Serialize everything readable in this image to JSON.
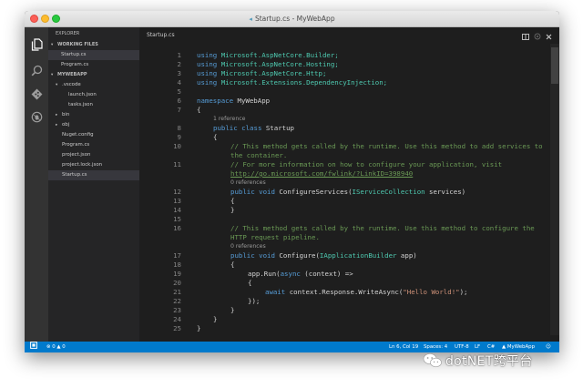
{
  "window": {
    "title": "Startup.cs - MyWebApp"
  },
  "sidebar": {
    "explorer_label": "EXPLORER",
    "working_files": {
      "label": "WORKING FILES",
      "items": [
        "Startup.cs",
        "Program.cs"
      ]
    },
    "project": {
      "label": "MYWEBAPP",
      "tree": [
        ".vscode",
        "launch.json",
        "tasks.json",
        "bin",
        "obj",
        "Nuget.config",
        "Program.cs",
        "project.json",
        "project.lock.json",
        "Startup.cs"
      ]
    }
  },
  "editor": {
    "title": "Startup.cs",
    "lines": [
      {
        "n": "1"
      },
      {
        "n": "2"
      },
      {
        "n": "3"
      },
      {
        "n": "4"
      },
      {
        "n": "5"
      },
      {
        "n": "6"
      },
      {
        "n": "7"
      },
      {
        "lens": "1 reference"
      },
      {
        "n": "8"
      },
      {
        "n": "9"
      },
      {
        "n": "10"
      },
      {
        "n": ""
      },
      {
        "n": "11"
      },
      {
        "n": ""
      },
      {
        "lens": "0 references"
      },
      {
        "n": "12"
      },
      {
        "n": "13"
      },
      {
        "n": "14"
      },
      {
        "n": "15"
      },
      {
        "n": "16"
      },
      {
        "n": ""
      },
      {
        "lens": "0 references"
      },
      {
        "n": "17"
      },
      {
        "n": "18"
      },
      {
        "n": "19"
      },
      {
        "n": "20"
      },
      {
        "n": "21"
      },
      {
        "n": "22"
      },
      {
        "n": "23"
      },
      {
        "n": "24"
      },
      {
        "n": "25"
      }
    ],
    "code": {
      "using": "using",
      "ns1": "Microsoft.AspNetCore.Builder;",
      "ns2": "Microsoft.AspNetCore.Hosting;",
      "ns3": "Microsoft.AspNetCore.Http;",
      "ns4": "Microsoft.Extensions.DependencyInjection;",
      "namespace_kw": "namespace",
      "namespace_name": "MyWebApp",
      "open_brace": "{",
      "close_brace": "}",
      "public_kw": "public",
      "class_kw": "class",
      "class_name": "Startup",
      "comment1a": "// This method gets called by the runtime. Use this method to add services to",
      "comment1b": "the container.",
      "comment2": "// For more information on how to configure your application, visit",
      "link": "http://go.microsoft.com/fwlink/?LinkID=398940",
      "void_kw": "void",
      "configure_services": "ConfigureServices(",
      "iservice": "IServiceCollection",
      "services_param": " services)",
      "comment3a": "// This method gets called by the runtime. Use this method to configure the",
      "comment3b": "HTTP request pipeline.",
      "configure": "Configure(",
      "iapp": "IApplicationBuilder",
      "app_param": " app)",
      "app_run": "app.Run(",
      "async_kw": "async",
      "context_lambda": " (context) =>",
      "await_kw": "await",
      "write_call": " context.Response.WriteAsync(",
      "hello": "\"Hello World!\"",
      "write_end": ");",
      "close_run": "});"
    }
  },
  "statusbar": {
    "errors": "0",
    "warnings": "0",
    "position": "Ln 6, Col 19",
    "spaces": "Spaces: 4",
    "encoding": "UTF-8",
    "eol": "LF",
    "language": "C#",
    "project": "MyWebApp"
  },
  "watermark": {
    "text": "dotNET跨平台"
  },
  "colors": {
    "keyword": "#569cd6",
    "type": "#4ec9b0",
    "comment": "#6a9955",
    "string": "#ce9178",
    "statusbar": "#007acc"
  }
}
